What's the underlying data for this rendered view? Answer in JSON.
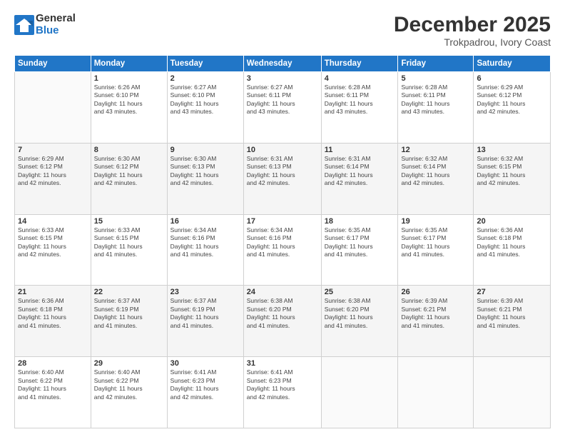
{
  "logo": {
    "general": "General",
    "blue": "Blue"
  },
  "title": "December 2025",
  "location": "Trokpadrou, Ivory Coast",
  "header_days": [
    "Sunday",
    "Monday",
    "Tuesday",
    "Wednesday",
    "Thursday",
    "Friday",
    "Saturday"
  ],
  "weeks": [
    [
      {
        "day": "",
        "info": ""
      },
      {
        "day": "1",
        "info": "Sunrise: 6:26 AM\nSunset: 6:10 PM\nDaylight: 11 hours\nand 43 minutes."
      },
      {
        "day": "2",
        "info": "Sunrise: 6:27 AM\nSunset: 6:10 PM\nDaylight: 11 hours\nand 43 minutes."
      },
      {
        "day": "3",
        "info": "Sunrise: 6:27 AM\nSunset: 6:11 PM\nDaylight: 11 hours\nand 43 minutes."
      },
      {
        "day": "4",
        "info": "Sunrise: 6:28 AM\nSunset: 6:11 PM\nDaylight: 11 hours\nand 43 minutes."
      },
      {
        "day": "5",
        "info": "Sunrise: 6:28 AM\nSunset: 6:11 PM\nDaylight: 11 hours\nand 43 minutes."
      },
      {
        "day": "6",
        "info": "Sunrise: 6:29 AM\nSunset: 6:12 PM\nDaylight: 11 hours\nand 42 minutes."
      }
    ],
    [
      {
        "day": "7",
        "info": "Sunrise: 6:29 AM\nSunset: 6:12 PM\nDaylight: 11 hours\nand 42 minutes."
      },
      {
        "day": "8",
        "info": "Sunrise: 6:30 AM\nSunset: 6:12 PM\nDaylight: 11 hours\nand 42 minutes."
      },
      {
        "day": "9",
        "info": "Sunrise: 6:30 AM\nSunset: 6:13 PM\nDaylight: 11 hours\nand 42 minutes."
      },
      {
        "day": "10",
        "info": "Sunrise: 6:31 AM\nSunset: 6:13 PM\nDaylight: 11 hours\nand 42 minutes."
      },
      {
        "day": "11",
        "info": "Sunrise: 6:31 AM\nSunset: 6:14 PM\nDaylight: 11 hours\nand 42 minutes."
      },
      {
        "day": "12",
        "info": "Sunrise: 6:32 AM\nSunset: 6:14 PM\nDaylight: 11 hours\nand 42 minutes."
      },
      {
        "day": "13",
        "info": "Sunrise: 6:32 AM\nSunset: 6:15 PM\nDaylight: 11 hours\nand 42 minutes."
      }
    ],
    [
      {
        "day": "14",
        "info": "Sunrise: 6:33 AM\nSunset: 6:15 PM\nDaylight: 11 hours\nand 42 minutes."
      },
      {
        "day": "15",
        "info": "Sunrise: 6:33 AM\nSunset: 6:15 PM\nDaylight: 11 hours\nand 41 minutes."
      },
      {
        "day": "16",
        "info": "Sunrise: 6:34 AM\nSunset: 6:16 PM\nDaylight: 11 hours\nand 41 minutes."
      },
      {
        "day": "17",
        "info": "Sunrise: 6:34 AM\nSunset: 6:16 PM\nDaylight: 11 hours\nand 41 minutes."
      },
      {
        "day": "18",
        "info": "Sunrise: 6:35 AM\nSunset: 6:17 PM\nDaylight: 11 hours\nand 41 minutes."
      },
      {
        "day": "19",
        "info": "Sunrise: 6:35 AM\nSunset: 6:17 PM\nDaylight: 11 hours\nand 41 minutes."
      },
      {
        "day": "20",
        "info": "Sunrise: 6:36 AM\nSunset: 6:18 PM\nDaylight: 11 hours\nand 41 minutes."
      }
    ],
    [
      {
        "day": "21",
        "info": "Sunrise: 6:36 AM\nSunset: 6:18 PM\nDaylight: 11 hours\nand 41 minutes."
      },
      {
        "day": "22",
        "info": "Sunrise: 6:37 AM\nSunset: 6:19 PM\nDaylight: 11 hours\nand 41 minutes."
      },
      {
        "day": "23",
        "info": "Sunrise: 6:37 AM\nSunset: 6:19 PM\nDaylight: 11 hours\nand 41 minutes."
      },
      {
        "day": "24",
        "info": "Sunrise: 6:38 AM\nSunset: 6:20 PM\nDaylight: 11 hours\nand 41 minutes."
      },
      {
        "day": "25",
        "info": "Sunrise: 6:38 AM\nSunset: 6:20 PM\nDaylight: 11 hours\nand 41 minutes."
      },
      {
        "day": "26",
        "info": "Sunrise: 6:39 AM\nSunset: 6:21 PM\nDaylight: 11 hours\nand 41 minutes."
      },
      {
        "day": "27",
        "info": "Sunrise: 6:39 AM\nSunset: 6:21 PM\nDaylight: 11 hours\nand 41 minutes."
      }
    ],
    [
      {
        "day": "28",
        "info": "Sunrise: 6:40 AM\nSunset: 6:22 PM\nDaylight: 11 hours\nand 41 minutes."
      },
      {
        "day": "29",
        "info": "Sunrise: 6:40 AM\nSunset: 6:22 PM\nDaylight: 11 hours\nand 42 minutes."
      },
      {
        "day": "30",
        "info": "Sunrise: 6:41 AM\nSunset: 6:23 PM\nDaylight: 11 hours\nand 42 minutes."
      },
      {
        "day": "31",
        "info": "Sunrise: 6:41 AM\nSunset: 6:23 PM\nDaylight: 11 hours\nand 42 minutes."
      },
      {
        "day": "",
        "info": ""
      },
      {
        "day": "",
        "info": ""
      },
      {
        "day": "",
        "info": ""
      }
    ]
  ]
}
